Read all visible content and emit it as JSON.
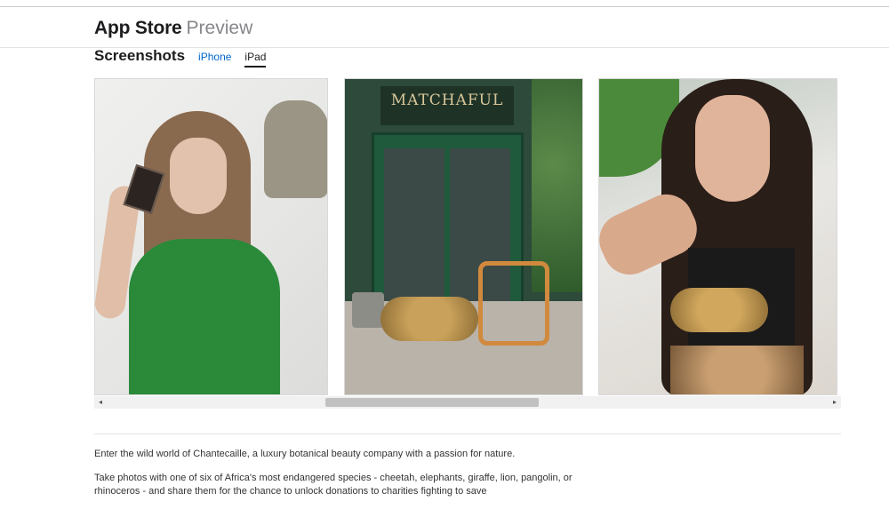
{
  "header": {
    "brand_main": "App Store",
    "brand_sub": "Preview"
  },
  "screenshots": {
    "title": "Screenshots",
    "tabs": [
      {
        "label": "iPhone",
        "active": false
      },
      {
        "label": "iPad",
        "active": true
      }
    ],
    "items": [
      {
        "name": "screenshot-woman-elephant"
      },
      {
        "name": "screenshot-cheetah-storefront",
        "sign_text": "MATCHAFUL"
      },
      {
        "name": "screenshot-woman-cheetah-selfie"
      }
    ]
  },
  "scrollbar": {
    "left_arrow": "◂",
    "right_arrow": "▸"
  },
  "description": {
    "paragraphs": [
      "Enter the wild world of Chantecaille, a luxury botanical beauty company with a passion for nature.",
      "Take photos with one of six of Africa's most endangered species - cheetah, elephants, giraffe, lion, pangolin, or rhinoceros - and share them for the chance to unlock donations to charities fighting to save"
    ]
  },
  "colors": {
    "link": "#0066cc",
    "text": "#1d1d1f",
    "muted": "#86868b"
  }
}
